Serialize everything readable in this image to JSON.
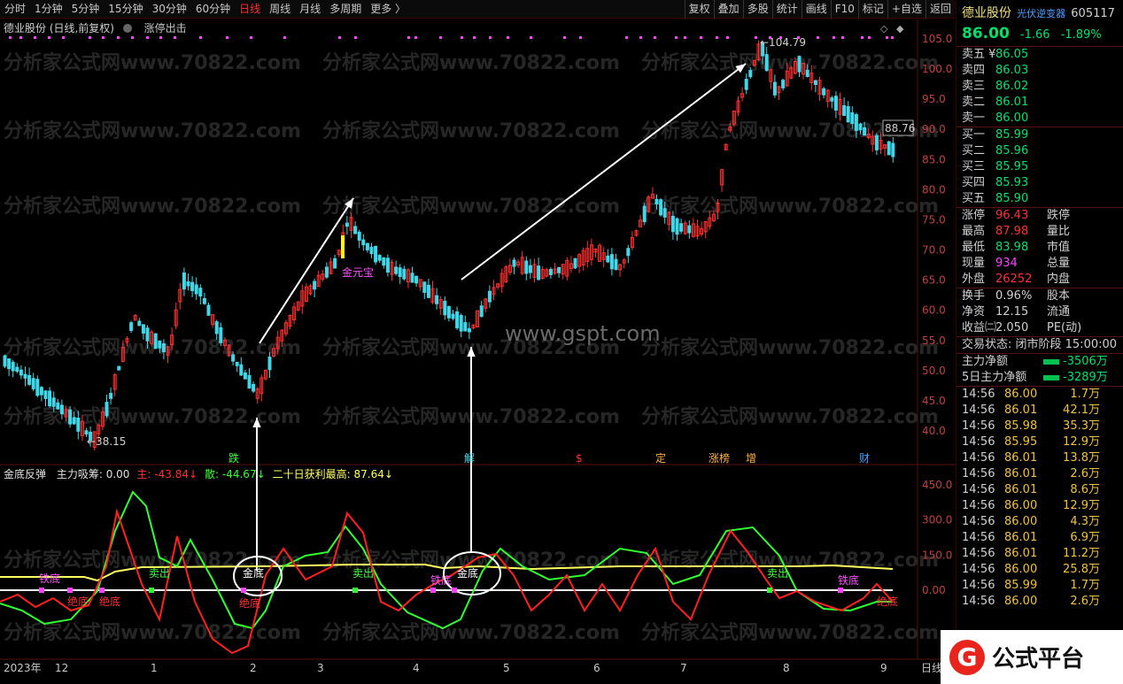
{
  "toolbar": {
    "periods": [
      "分时",
      "1分钟",
      "5分钟",
      "15分钟",
      "30分钟",
      "60分钟",
      "日线",
      "周线",
      "月线",
      "多周期",
      "更多 〉"
    ],
    "active": "日线",
    "actions": [
      "复权",
      "叠加",
      "多股",
      "统计",
      "画线",
      "F10",
      "标记",
      "+自选",
      "返回"
    ]
  },
  "main_chart": {
    "title": "德业股份 (日线,前复权)",
    "indicator": "涨停出击",
    "high_marker": "104.79",
    "low_marker": "38.15",
    "current_marker": "88.76",
    "label_jinyuanbao": "金元宝",
    "y_ticks": [
      "105.0",
      "100.0",
      "95.0",
      "90.0",
      "85.0",
      "80.0",
      "75.0",
      "70.0",
      "65.0",
      "60.0",
      "55.0",
      "50.0",
      "45.0",
      "40.0"
    ],
    "watermarks": [
      "分析家公式网www.70822.com"
    ],
    "watermark_gspt": "www.gspt.com",
    "events": [
      "跌",
      "解",
      "$",
      "定",
      "涨榜",
      "增",
      "财"
    ]
  },
  "indicator_chart": {
    "name": "金底反弹",
    "fields": [
      {
        "label": "主力吸筹: 0.00",
        "color": "#e0e0e0"
      },
      {
        "label": "主: -43.84↓",
        "color": "#ff3030"
      },
      {
        "label": "散: -44.67↓",
        "color": "#30ff30"
      },
      {
        "label": "二十日获利最高: 87.64↓",
        "color": "#ffff60"
      }
    ],
    "y_ticks": [
      "450.0",
      "300.0",
      "150.0",
      "0.00"
    ],
    "labels": {
      "tiedi": "铁底",
      "jindi": "金底",
      "maichu": "卖出",
      "jueji": "绝底"
    }
  },
  "x_axis": [
    "2023年",
    "12",
    "1",
    "2",
    "3",
    "4",
    "5",
    "6",
    "7",
    "8",
    "9"
  ],
  "x_axis_right": "日线",
  "quote": {
    "name": "德业股份",
    "tag": "光伏逆变器",
    "code": "605117",
    "price": "86.00",
    "change": "-1.66",
    "pct": "-1.89%",
    "asks": [
      {
        "label": "卖五 ¥",
        "price": "86.05"
      },
      {
        "label": "卖四",
        "price": "86.03"
      },
      {
        "label": "卖三",
        "price": "86.02"
      },
      {
        "label": "卖二",
        "price": "86.01"
      },
      {
        "label": "卖一",
        "price": "86.00"
      }
    ],
    "bids": [
      {
        "label": "买一",
        "price": "85.99"
      },
      {
        "label": "买二",
        "price": "85.96"
      },
      {
        "label": "买三",
        "price": "85.95"
      },
      {
        "label": "买四",
        "price": "85.93"
      },
      {
        "label": "买五",
        "price": "85.90"
      }
    ],
    "stats": [
      {
        "l": "涨停",
        "v": "96.43",
        "c": "#ff3030",
        "l2": "跌停"
      },
      {
        "l": "最高",
        "v": "87.98",
        "c": "#ff3030",
        "l2": "量比"
      },
      {
        "l": "最低",
        "v": "83.98",
        "c": "#00e06a",
        "l2": "市值"
      },
      {
        "l": "现量",
        "v": "934",
        "c": "#ff40ff",
        "l2": "总量"
      },
      {
        "l": "外盘",
        "v": "26252",
        "c": "#ff3030",
        "l2": "内盘"
      }
    ],
    "stats2": [
      {
        "l": "换手",
        "v": "0.96%",
        "l2": "股本"
      },
      {
        "l": "净资",
        "v": "12.15",
        "l2": "流通"
      },
      {
        "l": "收益㈡",
        "v": "2.050",
        "l2": "PE(动)"
      }
    ],
    "status": "交易状态: 闭市阶段 15:00:00",
    "flows": [
      {
        "label": "主力净额",
        "value": "-3506万"
      },
      {
        "label": "5日主力净额",
        "value": "-3289万"
      }
    ],
    "ticks": [
      {
        "t": "14:56",
        "p": "86.00",
        "v": "1.7万"
      },
      {
        "t": "14:56",
        "p": "86.01",
        "v": "42.1万"
      },
      {
        "t": "14:56",
        "p": "85.98",
        "v": "35.3万"
      },
      {
        "t": "14:56",
        "p": "85.95",
        "v": "12.9万"
      },
      {
        "t": "14:56",
        "p": "86.01",
        "v": "13.8万"
      },
      {
        "t": "14:56",
        "p": "86.01",
        "v": "2.6万"
      },
      {
        "t": "14:56",
        "p": "86.01",
        "v": "8.6万"
      },
      {
        "t": "14:56",
        "p": "86.00",
        "v": "12.9万"
      },
      {
        "t": "14:56",
        "p": "86.00",
        "v": "4.3万"
      },
      {
        "t": "14:56",
        "p": "86.01",
        "v": "6.9万"
      },
      {
        "t": "14:56",
        "p": "86.01",
        "v": "11.2万"
      },
      {
        "t": "14:56",
        "p": "86.00",
        "v": "25.8万"
      },
      {
        "t": "14:56",
        "p": "85.99",
        "v": "1.7万"
      },
      {
        "t": "14:56",
        "p": "86.00",
        "v": "2.6万"
      }
    ]
  },
  "logo_text": "公式平台",
  "logo_glyph": "G",
  "colors": {
    "up": "#ff3030",
    "down": "#40d8e8",
    "green": "#00e06a"
  }
}
